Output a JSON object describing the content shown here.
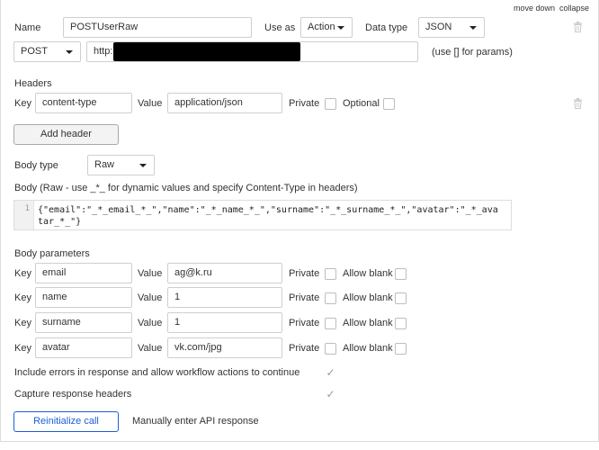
{
  "top_links": {
    "move_down": "move down",
    "collapse": "collapse"
  },
  "call": {
    "name_label": "Name",
    "name_value": "POSTUserRaw",
    "use_as_label": "Use as",
    "use_as_value": "Action",
    "data_type_label": "Data type",
    "data_type_value": "JSON",
    "method_value": "POST",
    "url_value": "http:",
    "url_hint": "(use [] for params)"
  },
  "headers": {
    "title": "Headers",
    "key_label": "Key",
    "value_label": "Value",
    "private_label": "Private",
    "optional_label": "Optional",
    "items": [
      {
        "key": "content-type",
        "value": "application/json"
      }
    ],
    "add_button": "Add header"
  },
  "body": {
    "type_label": "Body type",
    "type_value": "Raw",
    "raw_title": "Body (Raw - use _*_ for dynamic values and specify Content-Type in headers)",
    "line_number": "1",
    "code": "{\"email\":\"_*_email_*_\",\"name\":\"_*_name_*_\",\"surname\":\"_*_surname_*_\",\"avatar\":\"_*_avatar_*_\"}"
  },
  "body_params": {
    "title": "Body parameters",
    "key_label": "Key",
    "value_label": "Value",
    "private_label": "Private",
    "allow_blank_label": "Allow blank",
    "items": [
      {
        "key": "email",
        "value": "ag@k.ru"
      },
      {
        "key": "name",
        "value": "1"
      },
      {
        "key": "surname",
        "value": "1"
      },
      {
        "key": "avatar",
        "value": "vk.com/jpg"
      }
    ]
  },
  "options": {
    "include_errors_label": "Include errors in response and allow workflow actions to continue",
    "include_errors_checked": true,
    "capture_headers_label": "Capture response headers",
    "capture_headers_checked": true
  },
  "actions": {
    "reinitialize_button": "Reinitialize call",
    "manual_link": "Manually enter API response"
  },
  "colors": {
    "accent": "#1c5fd6",
    "border": "#cfcfcf",
    "check": "#9a9a9a"
  }
}
